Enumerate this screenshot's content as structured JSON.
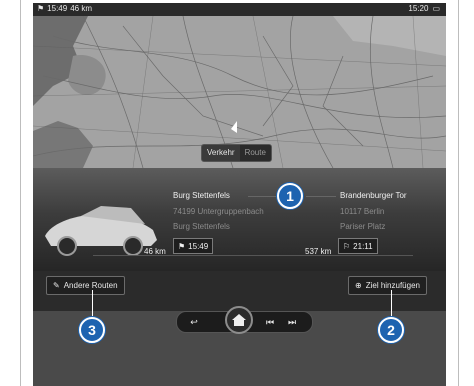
{
  "status": {
    "time_left": "15:49",
    "distance": "46 km",
    "time_right": "15:20"
  },
  "map": {
    "toggle": [
      "Verkehr",
      "Route"
    ],
    "toggle_active": 0
  },
  "route": {
    "origin": {
      "name": "Burg Stettenfels",
      "line2": "74199 Untergruppenbach",
      "line3": "Burg Stettenfels"
    },
    "destination": {
      "name": "Brandenburger Tor",
      "line2": "10117 Berlin",
      "line3": "Pariser Platz"
    },
    "driven_km": "46 km",
    "depart_time": "15:49",
    "remaining_km": "537 km",
    "arrival_time": "21:11"
  },
  "actions": {
    "other_routes": "Andere Routen",
    "add_destination": "Ziel hinzufügen"
  },
  "callouts": [
    "1",
    "2",
    "3"
  ],
  "colors": {
    "callout": "#1d63b0",
    "screen_dark": "#2b2b2b",
    "map_gray": "#9d9d9d"
  }
}
